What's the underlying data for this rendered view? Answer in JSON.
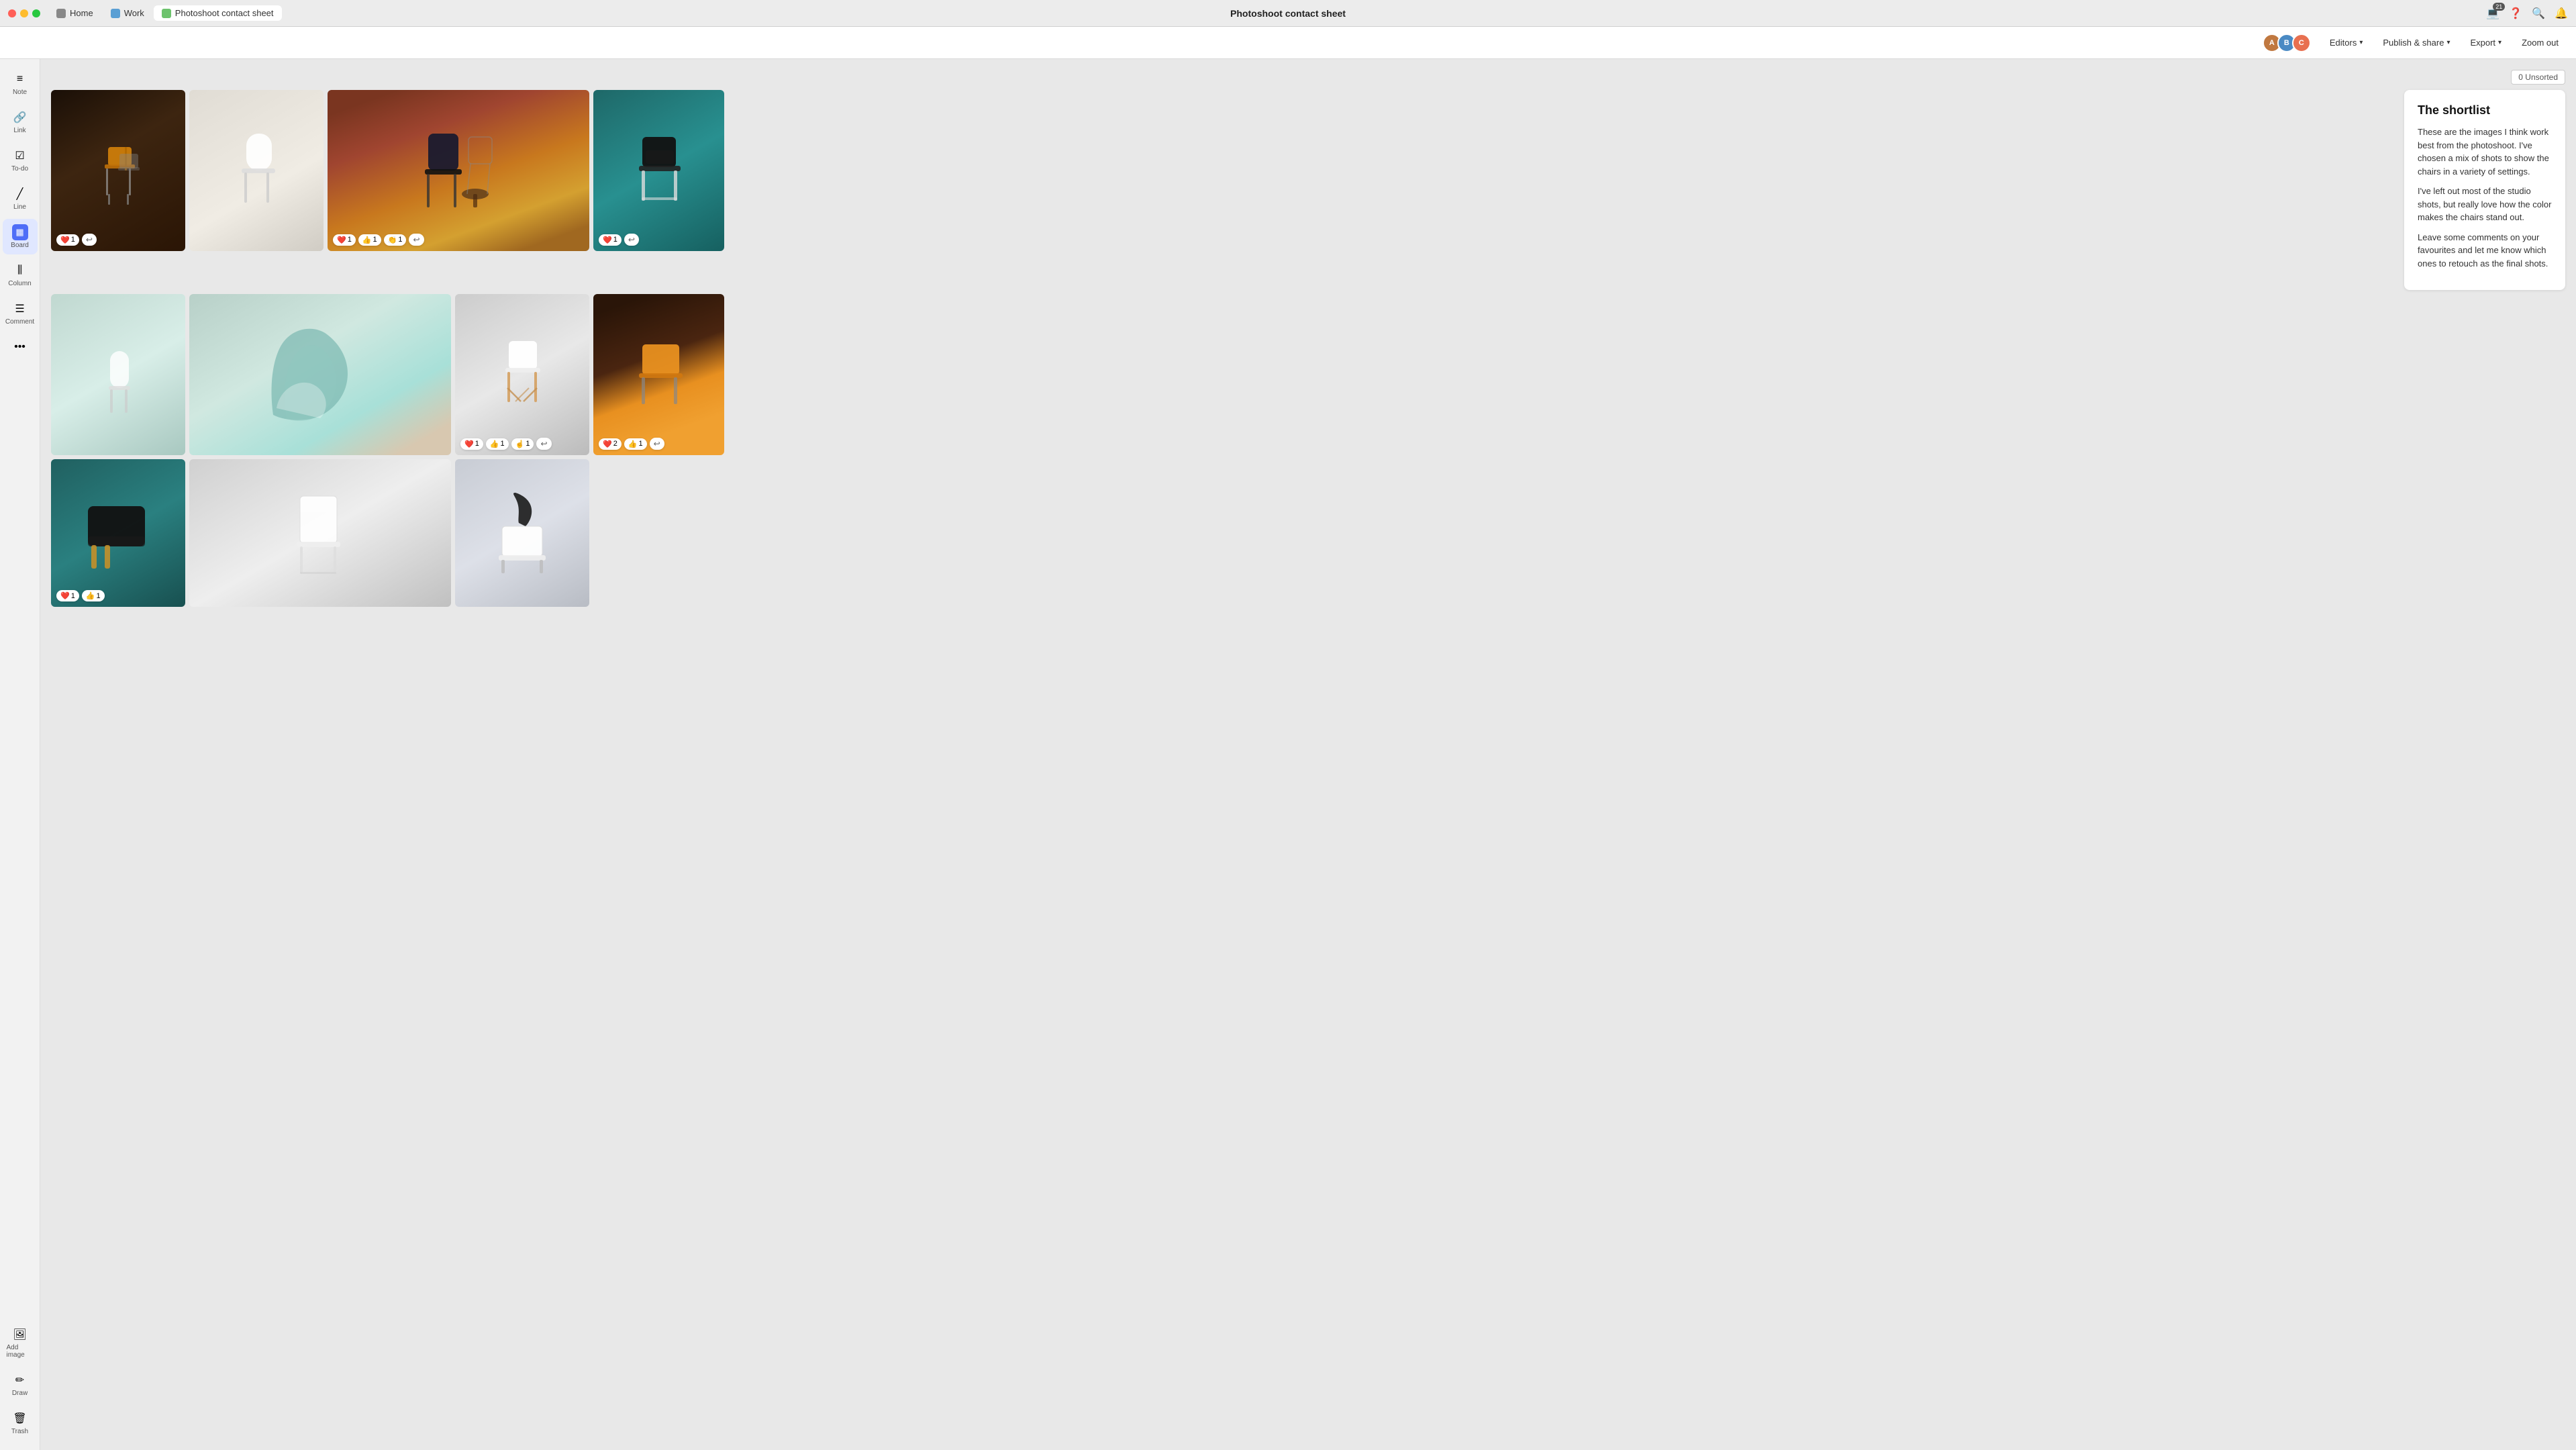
{
  "titleBar": {
    "tabs": [
      {
        "id": "home",
        "label": "Home",
        "icon": "home",
        "active": false
      },
      {
        "id": "work",
        "label": "Work",
        "icon": "work",
        "active": false
      },
      {
        "id": "doc",
        "label": "Photoshoot contact sheet",
        "icon": "doc",
        "active": true
      }
    ],
    "title": "Photoshoot contact sheet",
    "icons": {
      "device": "💻",
      "notification_count": "21",
      "help": "?",
      "search": "🔍",
      "bell": "🔔"
    }
  },
  "toolbar": {
    "editors_label": "Editors",
    "publish_label": "Publish & share",
    "export_label": "Export",
    "zoom_label": "Zoom out"
  },
  "sidebar": {
    "items": [
      {
        "id": "note",
        "icon": "≡",
        "label": "Note"
      },
      {
        "id": "link",
        "icon": "🔗",
        "label": "Link"
      },
      {
        "id": "todo",
        "icon": "☑",
        "label": "To-do"
      },
      {
        "id": "line",
        "icon": "╱",
        "label": "Line"
      },
      {
        "id": "board",
        "icon": "▦",
        "label": "Board",
        "active": true
      },
      {
        "id": "column",
        "icon": "⫼",
        "label": "Column"
      },
      {
        "id": "comment",
        "icon": "☰",
        "label": "Comment"
      },
      {
        "id": "more",
        "icon": "•••",
        "label": ""
      }
    ],
    "bottom_items": [
      {
        "id": "add-image",
        "icon": "🖼",
        "label": "Add image"
      },
      {
        "id": "draw",
        "icon": "✏",
        "label": "Draw"
      }
    ],
    "trash": {
      "label": "Trash"
    }
  },
  "board": {
    "unsorted_label": "0 Unsorted",
    "annotation": {
      "title": "The shortlist",
      "paragraphs": [
        "These are the images I think work best from the photoshoot. I've chosen a mix of shots to show the chairs in a variety of settings.",
        "I've left out most of the studio shots, but really love how the color makes the chairs stand out.",
        "Leave some comments on your favourites and let me know which ones to retouch as the final shots."
      ]
    },
    "images": [
      {
        "id": 1,
        "bg": "c1",
        "reactions": [
          {
            "emoji": "❤️",
            "count": "1"
          },
          {
            "type": "add"
          }
        ]
      },
      {
        "id": 2,
        "bg": "c2",
        "reactions": []
      },
      {
        "id": 3,
        "bg": "c3",
        "reactions": [
          {
            "emoji": "❤️",
            "count": "1"
          },
          {
            "emoji": "👍",
            "count": "1"
          },
          {
            "emoji": "👏",
            "count": "1"
          },
          {
            "type": "add"
          }
        ]
      },
      {
        "id": 4,
        "bg": "c4",
        "reactions": [
          {
            "emoji": "❤️",
            "count": "1"
          },
          {
            "type": "add"
          }
        ]
      },
      {
        "id": 5,
        "bg": "c5",
        "reactions": []
      },
      {
        "id": 6,
        "bg": "c6",
        "reactions": []
      },
      {
        "id": 7,
        "bg": "c7",
        "reactions": [
          {
            "emoji": "❤️",
            "count": "1"
          },
          {
            "emoji": "👍",
            "count": "1"
          },
          {
            "emoji": "👆",
            "count": "1"
          },
          {
            "type": "add"
          }
        ]
      },
      {
        "id": 8,
        "bg": "c8",
        "reactions": [
          {
            "emoji": "❤️",
            "count": "2"
          },
          {
            "emoji": "👍",
            "count": "1"
          },
          {
            "type": "add"
          }
        ]
      },
      {
        "id": 9,
        "bg": "c9",
        "reactions": [
          {
            "emoji": "❤️",
            "count": "1"
          },
          {
            "emoji": "👍",
            "count": "1"
          }
        ]
      },
      {
        "id": 10,
        "bg": "c10",
        "reactions": []
      },
      {
        "id": 11,
        "bg": "c11",
        "reactions": []
      }
    ]
  }
}
